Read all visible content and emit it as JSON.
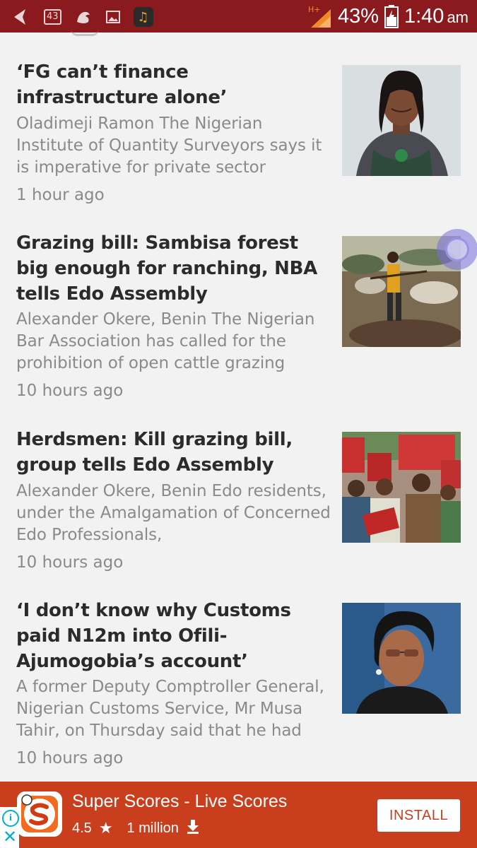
{
  "status_bar": {
    "notification_count": "43",
    "network_type": "H+",
    "battery": "43%",
    "time": "1:40",
    "ampm": "am"
  },
  "articles": [
    {
      "title": "‘FG can’t finance infrastructure alone’",
      "snippet": "Oladimeji Ramon The Nigerian Institute of Quantity Surveyors says it is imperative for private sector",
      "time": "1 hour ago"
    },
    {
      "title": "Grazing bill: Sambisa forest big enough for ranching, NBA tells Edo Assembly",
      "snippet": "Alexander Okere, Benin The Nigerian Bar Association has called for the prohibition of open cattle grazing",
      "time": "10 hours ago"
    },
    {
      "title": "Herdsmen: Kill grazing bill, group tells Edo Assembly",
      "snippet": "Alexander Okere, Benin Edo residents, under the Amalgamation of Concerned Edo Professionals,",
      "time": "10 hours ago"
    },
    {
      "title": "‘I  don’t know why Customs paid N12m into Ofili-Ajumogobia’s account’",
      "snippet": "A former Deputy Comptroller General, Nigerian Customs Service, Mr Musa Tahir, on Thursday said that he had",
      "time": "10 hours ago"
    }
  ],
  "ad": {
    "app_name": "Super Scores - Live Scores",
    "rating": "4.5",
    "downloads": "1 million",
    "install_label": "INSTALL",
    "brand_color": "#c93f1e"
  },
  "colors": {
    "status_bar": "#8b1a1f",
    "background": "#f2f2f2",
    "title_text": "#2b2b2b",
    "secondary_text": "#8a8a8a"
  }
}
